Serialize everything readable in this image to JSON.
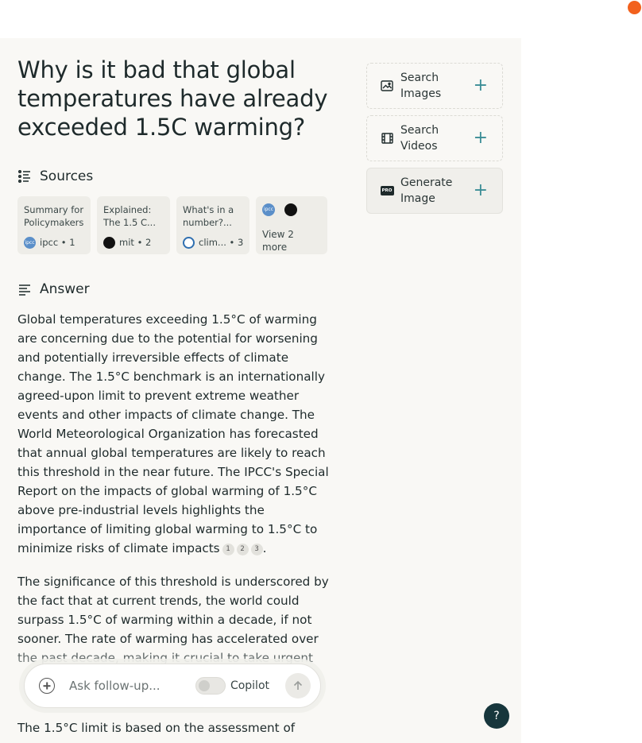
{
  "question": "Why is it bad that global temperatures have already exceeded 1.5C warming?",
  "sources": {
    "heading": "Sources",
    "cards": [
      {
        "title": "Summary for Policymakers",
        "site": "ipcc",
        "index": "1"
      },
      {
        "title": "Explained: The 1.5 C...",
        "site": "mit",
        "index": "2"
      },
      {
        "title": "What's in a number?...",
        "site": "clim...",
        "index": "3"
      }
    ],
    "more_label": "View 2 more",
    "more_icons": [
      "ipcc-icon",
      "mit-icon"
    ]
  },
  "answer": {
    "heading": "Answer",
    "p1": "Global temperatures exceeding 1.5°C of warming are concerning due to the potential for worsening and potentially irreversible effects of climate change. The 1.5°C benchmark is an internationally agreed-upon limit to prevent extreme weather events and other impacts of climate change. The World Meteorological Organization has forecasted that annual global temperatures are likely to reach this threshold in the near future. The IPCC's Special Report on the impacts of global warming of 1.5°C above pre-industrial levels highlights the importance of limiting global warming to 1.5°C to minimize risks of climate impacts",
    "p1_citations": [
      "1",
      "2",
      "3"
    ],
    "p1_end": ".",
    "p2": "The significance of this threshold is underscored by the fact that at current trends, the world could surpass 1.5°C of warming within a decade, if not sooner. The rate of warming has accelerated over the past decade, making it crucial to take urgent",
    "p3": "The 1.5°C limit is based on the assessment of"
  },
  "ask": {
    "placeholder": "Ask follow-up...",
    "copilot_label": "Copilot",
    "copilot_enabled": false
  },
  "sidebar": {
    "search_images": "Search Images",
    "search_videos": "Search Videos",
    "generate_image": "Generate Image",
    "pro_badge": "PRO"
  },
  "help_label": "?",
  "colors": {
    "accent": "#3b8d96",
    "recording_dot": "#f2611d",
    "help_bg": "#17363c"
  }
}
